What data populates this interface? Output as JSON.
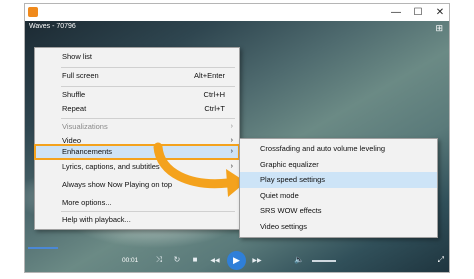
{
  "window": {
    "title": "Waves - 70796",
    "controls": {
      "minimize": "—",
      "maximize": "☐",
      "close": "✕"
    }
  },
  "context_menu": {
    "items": [
      {
        "label": "Show list",
        "shortcut": ""
      },
      {
        "label": "Full screen",
        "shortcut": "Alt+Enter"
      },
      {
        "label": "Shuffle",
        "shortcut": "Ctrl+H"
      },
      {
        "label": "Repeat",
        "shortcut": "Ctrl+T"
      },
      {
        "label": "Visualizations",
        "shortcut": ""
      },
      {
        "label": "Video",
        "shortcut": ""
      },
      {
        "label": "Enhancements",
        "shortcut": ""
      },
      {
        "label": "Lyrics, captions, and subtitles",
        "shortcut": ""
      },
      {
        "label": "Always show Now Playing on top",
        "shortcut": ""
      },
      {
        "label": "More options...",
        "shortcut": ""
      },
      {
        "label": "Help with playback...",
        "shortcut": ""
      }
    ],
    "submenu_arrow": "›"
  },
  "submenu": {
    "items": [
      "Crossfading and auto volume leveling",
      "Graphic equalizer",
      "Play speed settings",
      "Quiet mode",
      "SRS WOW effects",
      "Video settings"
    ],
    "highlighted": "Play speed settings"
  },
  "player": {
    "time": "00:01",
    "icons": [
      "shuffle-icon",
      "repeat-icon",
      "stop-icon",
      "previous-icon",
      "play-icon",
      "next-icon",
      "volume-icon"
    ],
    "glyphs": {
      "shuffle": "⤨",
      "repeat": "↻",
      "stop": "■",
      "previous": "◀◀",
      "play": "▶",
      "next": "▶▶",
      "volume": "🔈",
      "fullscreen": "⤢",
      "switch": "⊞"
    }
  },
  "colors": {
    "accent_orange": "#f4a21d",
    "highlight_blue": "#cde4f7",
    "play_blue": "#2f7fd8"
  }
}
